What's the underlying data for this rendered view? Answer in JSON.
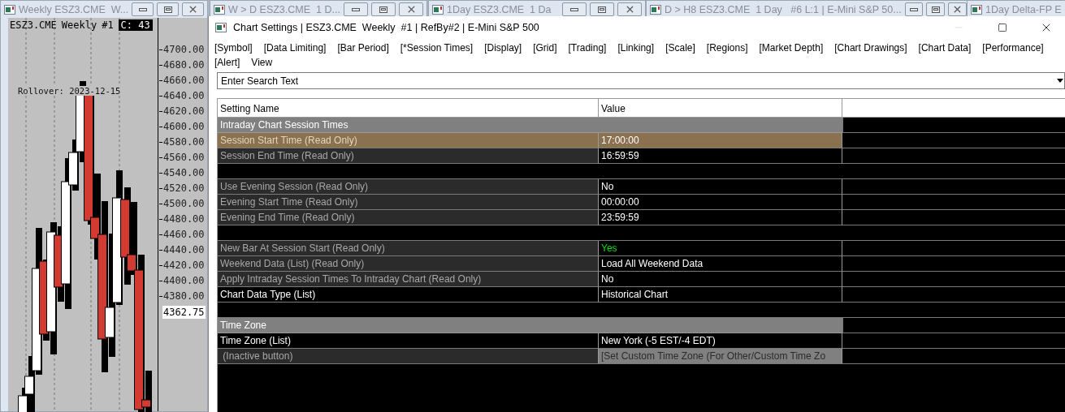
{
  "chart_window": {
    "title": "Weekly ESZ3.CME  W...",
    "symbol": "ESZ3.CME",
    "period": "Weekly",
    "chart_number": "#1",
    "close_label": "C: 43",
    "rollover": "Rollover: 2023-12-15",
    "price_labels": [
      "4700.00",
      "4680.00",
      "4660.00",
      "4640.00",
      "4620.00",
      "4600.00",
      "4580.00",
      "4560.00",
      "4540.00",
      "4520.00",
      "4500.00",
      "4480.00",
      "4460.00",
      "4440.00",
      "4420.00",
      "4400.00",
      "4380.00"
    ],
    "last_price": "4362.75"
  },
  "other_windows": [
    {
      "title": "W > D ESZ3.CME  1 D..."
    },
    {
      "title": "1Day ESZ3.CME  1 Da"
    },
    {
      "title": "D > H8 ESZ3.CME  1 Day   #6 L:1 | E-Mini S&P 50..."
    },
    {
      "title": "1Day Delta-FP E"
    }
  ],
  "dialog": {
    "title": "Chart Settings | ESZ3.CME  Weekly  #1 | RefBy#2 | E-Mini S&P 500",
    "menu": [
      "[Symbol]",
      "[Data Limiting]",
      "[Bar Period]",
      "[*Session Times]",
      "[Display]",
      "[Grid]",
      "[Trading]",
      "[Linking]",
      "[Scale]",
      "[Regions]",
      "[Market Depth]",
      "[Chart Drawings]",
      "[Chart Data]",
      "[Performance]",
      "[Alert]",
      "View"
    ],
    "search": {
      "placeholder": "Enter Search Text"
    },
    "table": {
      "columns": [
        "Setting Name",
        "Value"
      ],
      "rows": [
        {
          "kind": "group",
          "label": "Intraday Chart Session Times"
        },
        {
          "kind": "setting",
          "name": "Session Start Time (Read Only)",
          "value": "17:00:00",
          "read_only": true,
          "selected": true
        },
        {
          "kind": "setting",
          "name": "Session End Time (Read Only)",
          "value": "16:59:59",
          "read_only": true,
          "selected": false
        },
        {
          "kind": "spacer"
        },
        {
          "kind": "setting",
          "name": "Use Evening Session (Read Only)",
          "value": "No",
          "read_only": true,
          "selected": false
        },
        {
          "kind": "setting",
          "name": "Evening Start Time (Read Only)",
          "value": "00:00:00",
          "read_only": true,
          "selected": false
        },
        {
          "kind": "setting",
          "name": "Evening End Time (Read Only)",
          "value": "23:59:59",
          "read_only": true,
          "selected": false
        },
        {
          "kind": "spacer"
        },
        {
          "kind": "setting",
          "name": "New Bar At Session Start (Read Only)",
          "value": "Yes",
          "read_only": true,
          "selected": false,
          "color": "#00e000"
        },
        {
          "kind": "setting",
          "name": "Weekend Data (List) (Read Only)",
          "value": "Load All Weekend Data",
          "read_only": true,
          "selected": false
        },
        {
          "kind": "setting",
          "name": "Apply Intraday Session Times To Intraday Chart (Read Only)",
          "value": "No",
          "read_only": true,
          "selected": false
        },
        {
          "kind": "setting",
          "name": "Chart Data Type (List)",
          "value": "Historical Chart",
          "read_only": false,
          "selected": false
        },
        {
          "kind": "spacer"
        },
        {
          "kind": "group",
          "label": "Time Zone"
        },
        {
          "kind": "setting",
          "name": "Time Zone (List)",
          "value": "New York (-5 EST/-4 EDT)",
          "read_only": false,
          "selected": false
        },
        {
          "kind": "button",
          "name": " (Inactive button)",
          "value": "[Set Custom Time Zone (For Other/Custom Time Zo",
          "selected": false
        }
      ]
    }
  }
}
